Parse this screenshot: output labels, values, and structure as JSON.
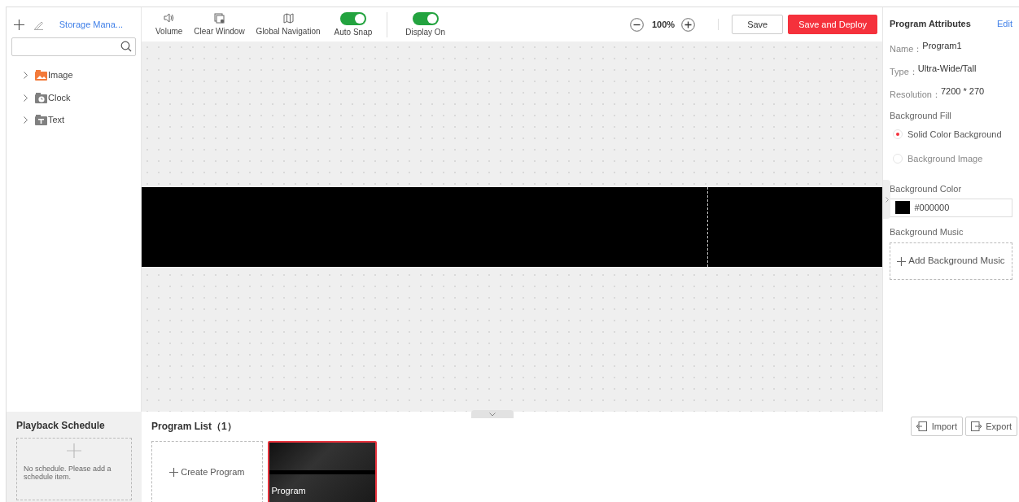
{
  "left_panel": {
    "storage_link": "Storage Mana...",
    "tree": [
      {
        "label": "Image",
        "kind": "image",
        "expanded": false
      },
      {
        "label": "Clock",
        "kind": "clock",
        "expanded": false
      },
      {
        "label": "Text",
        "kind": "text",
        "expanded": false
      }
    ]
  },
  "toolbar": {
    "tools": [
      {
        "label": "Volume",
        "kind": "volume"
      },
      {
        "label": "Clear Window",
        "kind": "clear"
      },
      {
        "label": "Global Navigation",
        "kind": "map"
      }
    ],
    "toggles": [
      {
        "label": "Auto Snap",
        "on": true
      },
      {
        "label": "Display On",
        "on": true
      }
    ],
    "zoom": "100%",
    "buttons": [
      {
        "label": "Save",
        "kind": "default"
      },
      {
        "label": "Save and Deploy",
        "kind": "primary"
      }
    ]
  },
  "properties": {
    "title": "Program Attributes",
    "edit": "Edit",
    "fields": [
      {
        "label": "Name：",
        "value": "Program1"
      },
      {
        "label": "Type：",
        "value": "Ultra-Wide/Tall"
      },
      {
        "label": "Resolution：",
        "value": "7200 * 270"
      }
    ],
    "fill_label": "Background Fill",
    "fill_options": [
      {
        "label": "Solid Color Background",
        "selected": true
      },
      {
        "label": "Background Image",
        "selected": false
      }
    ],
    "color_label": "Background Color",
    "color_value": "#000000",
    "music_label": "Background Music",
    "add_music": "Add Background Music"
  },
  "schedule": {
    "title": "Playback Schedule",
    "empty_text": "No schedule. Please add a schedule item."
  },
  "program_list": {
    "title": "Program List（1）",
    "create": "Create Program",
    "programs": [
      {
        "label": "Program",
        "selected": true
      }
    ],
    "actions": [
      {
        "label": "Import",
        "kind": "import"
      },
      {
        "label": "Export",
        "kind": "export"
      }
    ]
  }
}
